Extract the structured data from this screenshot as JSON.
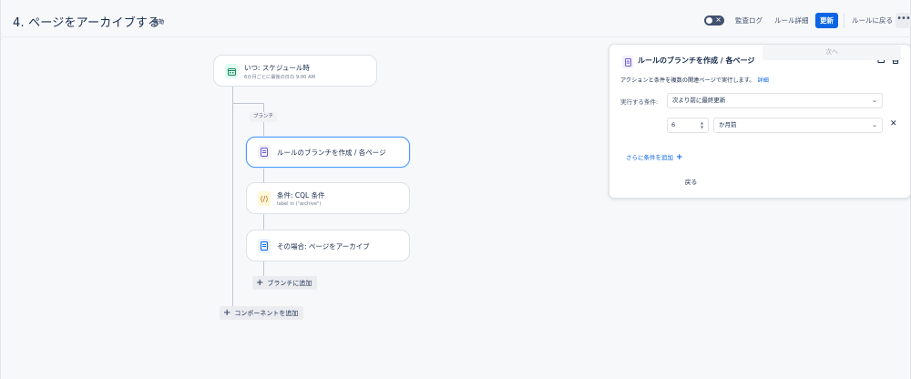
{
  "header": {
    "title": "4. ページをアーカイブする",
    "status": "無効",
    "toggle_icon": "close-icon",
    "audit_log": "監査ログ",
    "rule_details": "ルール詳細",
    "update": "更新",
    "back_to_rules": "ルールに戻る",
    "more_icon": "more-icon",
    "colors": {
      "primary": "#0c66e4",
      "toggle": "#42526e"
    }
  },
  "flow": {
    "trigger": {
      "title": "いつ: スケジュール時",
      "subtitle": "6か月ごとに最後の日の 9:00 AM",
      "icon": "calendar-icon"
    },
    "branch_chip": "ブランチ",
    "branch_card": {
      "title": "ルールのブランチを作成 / 各ページ",
      "icon": "document-icon"
    },
    "condition_card": {
      "title": "条件: CQL 条件",
      "subtitle": "label in (\"archive\")",
      "icon": "code-icon"
    },
    "action_card": {
      "title": "その場合: ページをアーカイブ",
      "icon": "page-icon"
    },
    "add_to_branch": "ブランチに追加",
    "add_component": "コンポーネントを追加"
  },
  "panel": {
    "title": "ルールのブランチを作成 / 各ページ",
    "description": "アクションと条件を複数の関連ページで実行します。",
    "details_link": "詳細",
    "condition_label": "実行する条件:",
    "condition_select": "次より前に最終更新",
    "amount_value": "6",
    "unit_select": "か月前",
    "add_more_conditions": "さらに条件を追加",
    "back": "戻る",
    "next": "次へ"
  }
}
